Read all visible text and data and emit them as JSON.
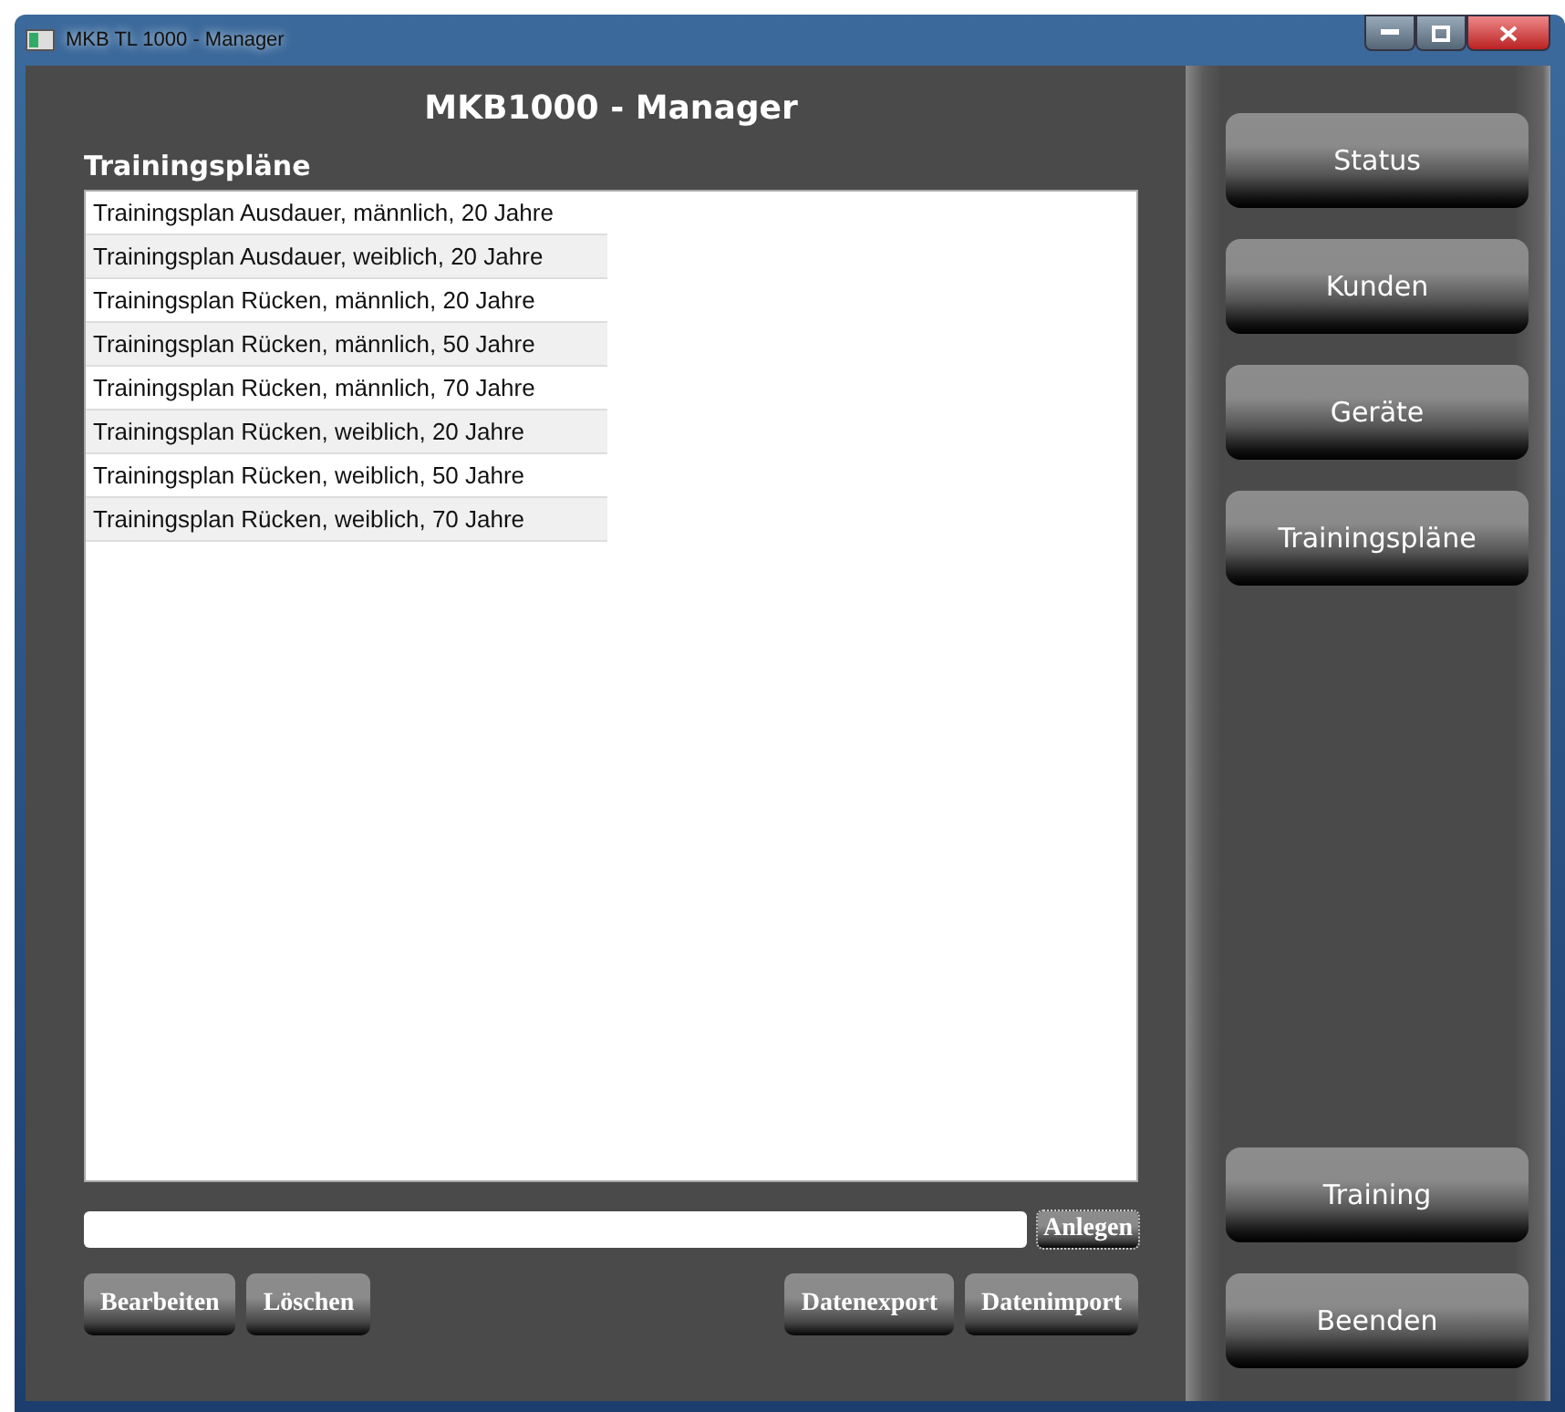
{
  "window": {
    "title": "MKB TL 1000 - Manager"
  },
  "header": {
    "title": "MKB1000 - Manager"
  },
  "plans": {
    "heading": "Trainingspläne",
    "items": [
      {
        "label": "Trainingsplan Ausdauer, männlich, 20 Jahre"
      },
      {
        "label": "Trainingsplan Ausdauer, weiblich, 20 Jahre"
      },
      {
        "label": "Trainingsplan Rücken, männlich, 20 Jahre"
      },
      {
        "label": "Trainingsplan Rücken, männlich, 50 Jahre"
      },
      {
        "label": "Trainingsplan Rücken, männlich, 70 Jahre"
      },
      {
        "label": "Trainingsplan Rücken, weiblich, 20 Jahre"
      },
      {
        "label": "Trainingsplan Rücken, weiblich, 50 Jahre"
      },
      {
        "label": "Trainingsplan Rücken, weiblich, 70 Jahre"
      }
    ]
  },
  "create": {
    "button": "Anlegen"
  },
  "actions_left": [
    "Bearbeiten",
    "Löschen"
  ],
  "actions_right": [
    "Datenexport",
    "Datenimport"
  ],
  "nav_top": [
    "Status",
    "Kunden",
    "Geräte",
    "Trainingspläne"
  ],
  "nav_bottom": [
    "Training",
    "Beenden"
  ]
}
